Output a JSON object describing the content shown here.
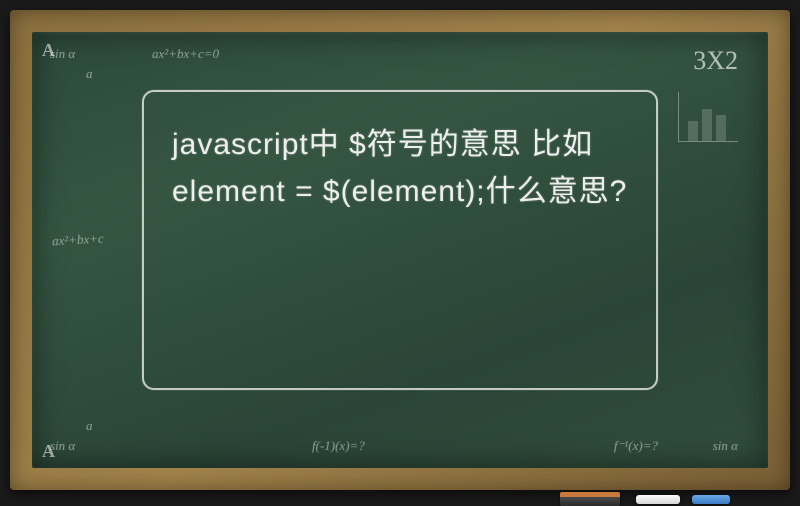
{
  "question": {
    "line1": "javascript中 $符号的意思 比如element = $(element);什么意思?"
  },
  "decorations": {
    "formula_tl": "sin α",
    "formula_tl2": "a",
    "formula_tl3": "ax²+bx+c=0",
    "formula_tr": "3X2",
    "formula_bl": "sin α",
    "formula_bl2": "a",
    "formula_bm": "f(-1)(x)=?",
    "formula_br": "f⁻¹(x)=?",
    "formula_br2": "sin α",
    "formula_ml": "ax²+bx+c",
    "corner_A_top": "A",
    "corner_A_bottom": "A"
  }
}
